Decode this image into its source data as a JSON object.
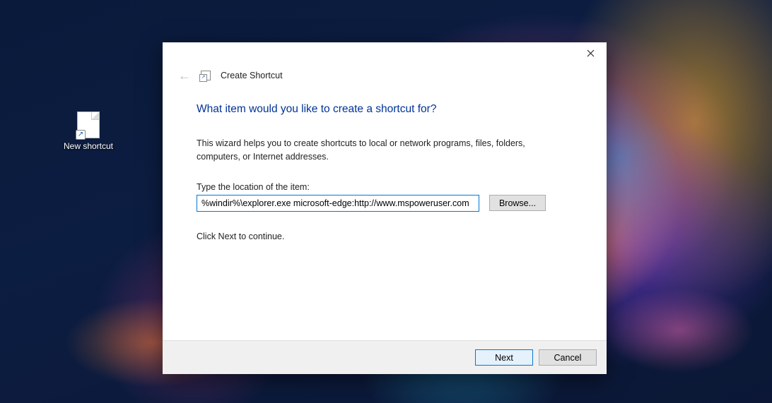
{
  "desktop": {
    "icon_label": "New shortcut"
  },
  "dialog": {
    "wizard_title": "Create Shortcut",
    "heading": "What item would you like to create a shortcut for?",
    "description": "This wizard helps you to create shortcuts to local or network programs, files, folders, computers, or Internet addresses.",
    "location_label": "Type the location of the item:",
    "location_value": "%windir%\\explorer.exe microsoft-edge:http://www.mspoweruser.com",
    "browse_label": "Browse...",
    "continue_text": "Click Next to continue.",
    "next_label": "Next",
    "cancel_label": "Cancel"
  }
}
